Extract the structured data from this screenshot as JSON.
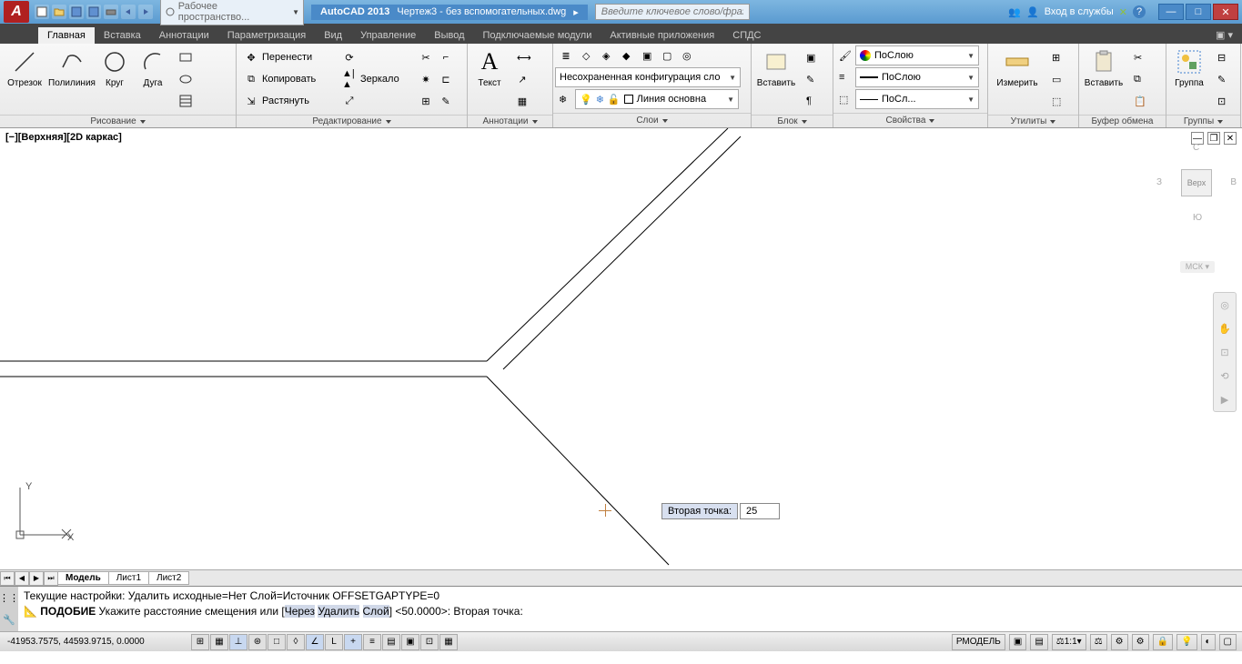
{
  "titlebar": {
    "workspace": "Рабочее пространство...",
    "app": "AutoCAD 2013",
    "filename": "Чертеж3 - без вспомогательных.dwg",
    "search_placeholder": "Введите ключевое слово/фразу",
    "signin": "Вход в службы"
  },
  "ribbon_tabs": [
    "Главная",
    "Вставка",
    "Аннотации",
    "Параметризация",
    "Вид",
    "Управление",
    "Вывод",
    "Подключаемые модули",
    "Активные приложения",
    "СПДС"
  ],
  "panels": {
    "draw": {
      "label": "Рисование",
      "items": {
        "line": "Отрезок",
        "polyline": "Полилиния",
        "circle": "Круг",
        "arc": "Дуга"
      }
    },
    "modify": {
      "label": "Редактирование",
      "items": {
        "move": "Перенести",
        "copy": "Копировать",
        "stretch": "Растянуть",
        "rotate": "Повернуть",
        "mirror": "Зеркало",
        "scale": "Масштаб"
      }
    },
    "annotation": {
      "label": "Аннотации",
      "text": "Текст"
    },
    "layers": {
      "label": "Слои",
      "config": "Несохраненная конфигурация сло",
      "linetype": "Линия основна"
    },
    "block": {
      "label": "Блок",
      "insert": "Вставить"
    },
    "properties": {
      "label": "Свойства",
      "bylayer": "ПоСлою",
      "bylayer2": "ПоСлою",
      "bylayer3": "ПоСл..."
    },
    "utilities": {
      "label": "Утилиты",
      "measure": "Измерить"
    },
    "clipboard": {
      "label": "Буфер обмена",
      "paste": "Вставить"
    },
    "groups": {
      "label": "Группы",
      "group": "Группа"
    }
  },
  "drawing": {
    "view_label": "[−][Верхняя][2D каркас]",
    "viewcube": {
      "top": "С",
      "left": "З",
      "right": "В",
      "bottom": "Ю",
      "face": "Верх"
    },
    "msk": "МСК",
    "dyn_label": "Вторая точка:",
    "dyn_value": "25"
  },
  "layout_tabs": [
    "Модель",
    "Лист1",
    "Лист2"
  ],
  "command": {
    "line1": "Текущие настройки: Удалить исходные=Нет  Слой=Источник  OFFSETGAPTYPE=0",
    "prefix": "ПОДОБИЕ",
    "text": " Укажите расстояние смещения или [",
    "kw1": "Через",
    "kw2": "Удалить",
    "kw3": "Слой",
    "suffix": "] <50.0000>:   Вторая точка:"
  },
  "statusbar": {
    "coords": "-41953.7575, 44593.9715, 0.0000",
    "model": "РМОДЕЛЬ",
    "scale": "1:1"
  }
}
